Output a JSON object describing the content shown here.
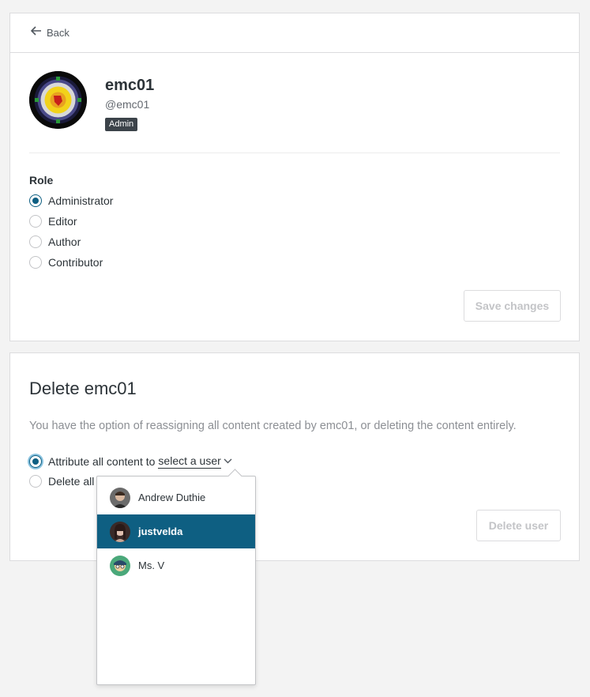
{
  "back": {
    "label": "Back",
    "icon": "arrow-left-icon"
  },
  "user": {
    "display_name": "emc01",
    "handle": "@emc01",
    "badge": "Admin"
  },
  "role": {
    "title": "Role",
    "options": [
      {
        "label": "Administrator",
        "checked": true
      },
      {
        "label": "Editor",
        "checked": false
      },
      {
        "label": "Author",
        "checked": false
      },
      {
        "label": "Contributor",
        "checked": false
      }
    ],
    "save_label": "Save changes"
  },
  "delete_section": {
    "title": "Delete emc01",
    "description": "You have the option of reassigning all content created by emc01, or deleting the content entirely.",
    "attribute_label": "Attribute all content to",
    "select_user_label": "select a user",
    "delete_all_label": "Delete all",
    "delete_button_label": "Delete user"
  },
  "user_dropdown": {
    "items": [
      {
        "name": "Andrew Duthie",
        "selected": false
      },
      {
        "name": "justvelda",
        "selected": true
      },
      {
        "name": "Ms. V",
        "selected": false
      }
    ]
  },
  "colors": {
    "accent": "#0e5f82",
    "badge_bg": "#3c434a",
    "page_bg": "#f3f3f3"
  }
}
